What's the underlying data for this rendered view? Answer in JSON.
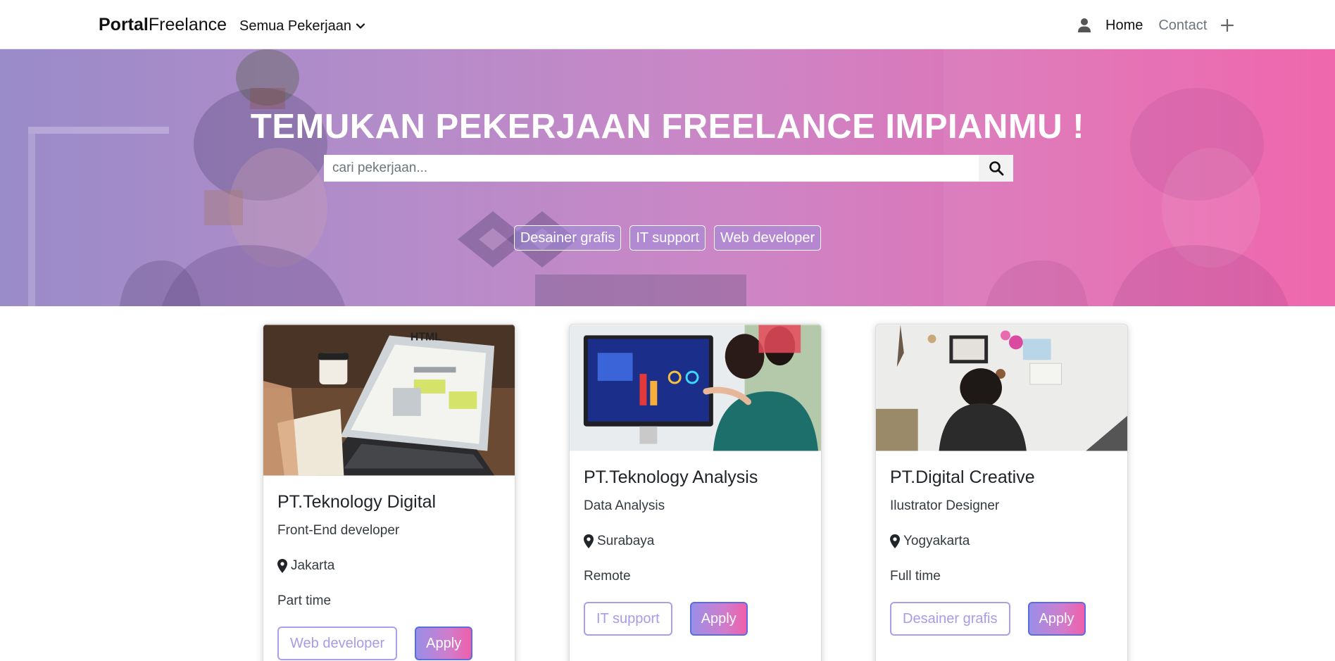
{
  "navbar": {
    "brand_bold": "Portal",
    "brand_light": "Freelance",
    "dropdown_label": "Semua Pekerjaan",
    "home": "Home",
    "contact": "Contact"
  },
  "hero": {
    "title": "TEMUKAN PEKERJAAN FREELANCE IMPIANMU !",
    "search_placeholder": "cari pekerjaan...",
    "tags": [
      "Desainer grafis",
      "IT support",
      "Web developer"
    ]
  },
  "cards": [
    {
      "company": "PT.Teknology Digital",
      "role": "Front-End developer",
      "location": "Jakarta",
      "type": "Part time",
      "tag": "Web developer",
      "apply": "Apply"
    },
    {
      "company": "PT.Teknology Analysis",
      "role": "Data Analysis",
      "location": "Surabaya",
      "type": "Remote",
      "tag": "IT support",
      "apply": "Apply"
    },
    {
      "company": "PT.Digital Creative",
      "role": "Ilustrator Designer",
      "location": "Yogyakarta",
      "type": "Full time",
      "tag": "Desainer grafis",
      "apply": "Apply"
    }
  ],
  "colors": {
    "hero_gradient_start": "#9a8bc9",
    "hero_gradient_end": "#ef5fa9",
    "outline_button": "#a8a0ec",
    "apply_border": "#5a6de0"
  },
  "icons": [
    "user-icon",
    "plus-icon",
    "chevron-down-icon",
    "search-icon",
    "map-marker-icon"
  ]
}
